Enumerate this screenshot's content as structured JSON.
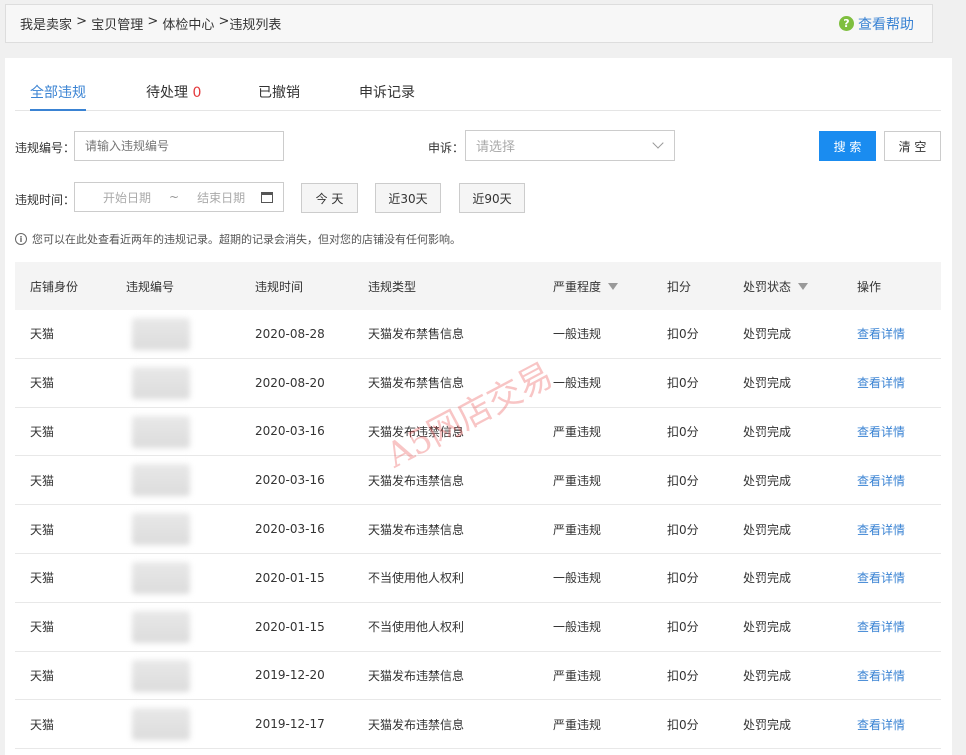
{
  "breadcrumb": {
    "items": [
      "我是卖家",
      " > ",
      "宝贝管理",
      " > ",
      "体检中心",
      " >",
      "违规列表"
    ]
  },
  "help": {
    "icon": "question-icon",
    "label": "查看帮助"
  },
  "tabs": [
    {
      "label": "全部违规",
      "count": ""
    },
    {
      "label": "待处理",
      "count": "0"
    },
    {
      "label": "已撤销",
      "count": ""
    },
    {
      "label": "申诉记录",
      "count": ""
    }
  ],
  "filters": {
    "violation_id_label": "违规编号：",
    "violation_id_placeholder": "请输入违规编号",
    "appeal_label": "申诉：",
    "appeal_placeholder": "请选择",
    "search_button": "搜 索",
    "clear_button": "清 空",
    "time_label": "违规时间：",
    "start_date_placeholder": "开始日期",
    "date_separator": "~",
    "end_date_placeholder": "结束日期",
    "today_button": "今 天",
    "last30_button": "近30天",
    "last90_button": "近90天"
  },
  "notice": "您可以在此处查看近两年的违规记录。超期的记录会消失，但对您的店铺没有任何影响。",
  "table": {
    "headers": {
      "shop_identity": "店铺身份",
      "violation_id": "违规编号",
      "violation_time": "违规时间",
      "violation_type": "违规类型",
      "severity": "严重程度",
      "deduction": "扣分",
      "penalty_status": "处罚状态",
      "action": "操作"
    },
    "rows": [
      {
        "shop": "天猫",
        "time": "2020-08-28",
        "type": "天猫发布禁售信息",
        "severity": "一般违规",
        "deduction": "扣0分",
        "status": "处罚完成",
        "action": "查看详情"
      },
      {
        "shop": "天猫",
        "time": "2020-08-20",
        "type": "天猫发布禁售信息",
        "severity": "一般违规",
        "deduction": "扣0分",
        "status": "处罚完成",
        "action": "查看详情"
      },
      {
        "shop": "天猫",
        "time": "2020-03-16",
        "type": "天猫发布违禁信息",
        "severity": "严重违规",
        "deduction": "扣0分",
        "status": "处罚完成",
        "action": "查看详情"
      },
      {
        "shop": "天猫",
        "time": "2020-03-16",
        "type": "天猫发布违禁信息",
        "severity": "严重违规",
        "deduction": "扣0分",
        "status": "处罚完成",
        "action": "查看详情"
      },
      {
        "shop": "天猫",
        "time": "2020-03-16",
        "type": "天猫发布违禁信息",
        "severity": "严重违规",
        "deduction": "扣0分",
        "status": "处罚完成",
        "action": "查看详情"
      },
      {
        "shop": "天猫",
        "time": "2020-01-15",
        "type": "不当使用他人权利",
        "severity": "一般违规",
        "deduction": "扣0分",
        "status": "处罚完成",
        "action": "查看详情"
      },
      {
        "shop": "天猫",
        "time": "2020-01-15",
        "type": "不当使用他人权利",
        "severity": "一般违规",
        "deduction": "扣0分",
        "status": "处罚完成",
        "action": "查看详情"
      },
      {
        "shop": "天猫",
        "time": "2019-12-20",
        "type": "天猫发布违禁信息",
        "severity": "严重违规",
        "deduction": "扣0分",
        "status": "处罚完成",
        "action": "查看详情"
      },
      {
        "shop": "天猫",
        "time": "2019-12-17",
        "type": "天猫发布违禁信息",
        "severity": "严重违规",
        "deduction": "扣0分",
        "status": "处罚完成",
        "action": "查看详情"
      }
    ]
  },
  "watermark": "A5网店交易",
  "colors": {
    "accent": "#3a83d3",
    "primary_button": "#1a8cf0",
    "count_red": "#e4393c",
    "help_icon": "#7fbf3f"
  }
}
